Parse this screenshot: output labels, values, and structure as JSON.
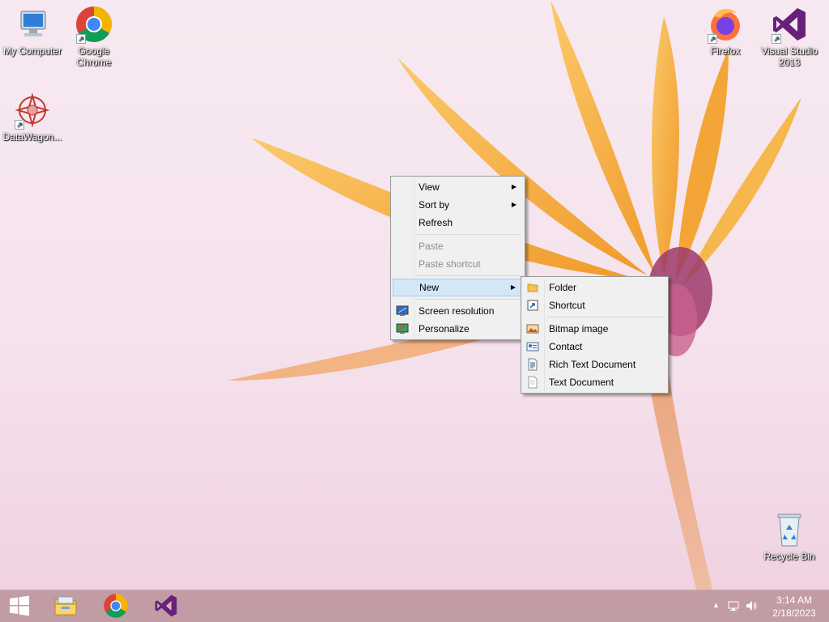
{
  "desktop": {
    "icons": [
      {
        "label": "My Computer",
        "icon": "computer-icon"
      },
      {
        "label": "Google Chrome",
        "icon": "chrome-icon"
      },
      {
        "label": "DataWagon...",
        "icon": "datawagon-icon"
      },
      {
        "label": "Firefox",
        "icon": "firefox-icon"
      },
      {
        "label": "Visual Studio 2013",
        "icon": "visual-studio-icon"
      },
      {
        "label": "Recycle Bin",
        "icon": "recycle-bin-icon"
      }
    ]
  },
  "context_menu": {
    "items": [
      {
        "label": "View",
        "submenu": true
      },
      {
        "label": "Sort by",
        "submenu": true
      },
      {
        "label": "Refresh"
      },
      {
        "label": "Paste",
        "disabled": true
      },
      {
        "label": "Paste shortcut",
        "disabled": true
      },
      {
        "label": "New",
        "submenu": true,
        "highlighted": true
      },
      {
        "label": "Screen resolution",
        "icon": "screen-resolution-icon"
      },
      {
        "label": "Personalize",
        "icon": "personalize-icon"
      }
    ]
  },
  "new_submenu": {
    "items": [
      {
        "label": "Folder",
        "icon": "folder-icon"
      },
      {
        "label": "Shortcut",
        "icon": "shortcut-icon"
      },
      {
        "label": "Bitmap image",
        "icon": "bitmap-icon"
      },
      {
        "label": "Contact",
        "icon": "contact-icon"
      },
      {
        "label": "Rich Text Document",
        "icon": "rich-text-icon"
      },
      {
        "label": "Text Document",
        "icon": "text-document-icon"
      }
    ]
  },
  "taskbar": {
    "buttons": [
      {
        "name": "start",
        "icon": "windows-logo-icon"
      },
      {
        "name": "file-explorer",
        "icon": "file-explorer-icon"
      },
      {
        "name": "chrome",
        "icon": "chrome-icon"
      },
      {
        "name": "visual-studio",
        "icon": "visual-studio-icon"
      }
    ],
    "tray": {
      "icons": [
        "show-hidden-icons-icon",
        "network-icon",
        "volume-icon"
      ],
      "time": "3:14 AM",
      "date": "2/18/2023"
    }
  },
  "colors": {
    "menu_highlight": "#d5e6f7",
    "taskbar": "#bc949c",
    "petal": "#f6b23a"
  }
}
